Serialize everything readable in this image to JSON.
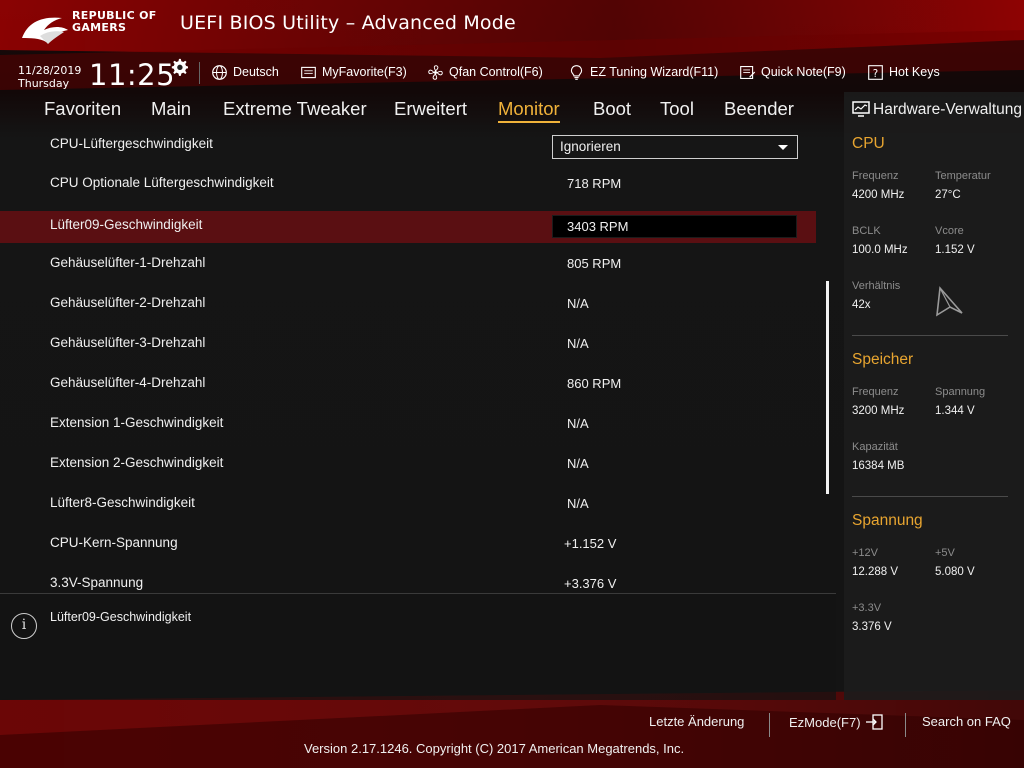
{
  "header": {
    "logo_line1": "REPUBLIC OF",
    "logo_line2": "GAMERS",
    "title": "UEFI BIOS Utility – Advanced Mode"
  },
  "infobar": {
    "date": "11/28/2019",
    "weekday": "Thursday",
    "time": "11:25",
    "language": "Deutsch",
    "myfavorite": "MyFavorite(F3)",
    "qfan": "Qfan Control(F6)",
    "ez_tuning": "EZ Tuning Wizard(F11)",
    "quick_note": "Quick Note(F9)",
    "hot_keys": "Hot Keys"
  },
  "tabs": [
    {
      "label": "Favoriten"
    },
    {
      "label": "Main"
    },
    {
      "label": "Extreme Tweaker"
    },
    {
      "label": "Erweitert"
    },
    {
      "label": "Monitor",
      "active": true
    },
    {
      "label": "Boot"
    },
    {
      "label": "Tool"
    },
    {
      "label": "Beender"
    }
  ],
  "rows": [
    {
      "label": "CPU-Lüftergeschwindigkeit",
      "value": "Ignorieren",
      "type": "dropdown"
    },
    {
      "label": "CPU Optionale Lüftergeschwindigkeit",
      "value": "718 RPM"
    },
    {
      "label": "Lüfter09-Geschwindigkeit",
      "value": "3403 RPM",
      "selected": true
    },
    {
      "label": "Gehäuselüfter-1-Drehzahl",
      "value": "805 RPM"
    },
    {
      "label": "Gehäuselüfter-2-Drehzahl",
      "value": "N/A"
    },
    {
      "label": "Gehäuselüfter-3-Drehzahl",
      "value": "N/A"
    },
    {
      "label": "Gehäuselüfter-4-Drehzahl",
      "value": "860 RPM"
    },
    {
      "label": "Extension 1-Geschwindigkeit",
      "value": "N/A"
    },
    {
      "label": "Extension 2-Geschwindigkeit",
      "value": "N/A"
    },
    {
      "label": "Lüfter8-Geschwindigkeit",
      "value": "N/A"
    },
    {
      "label": "CPU-Kern-Spannung",
      "value": "+1.152 V"
    },
    {
      "label": "3.3V-Spannung",
      "value": "+3.376 V"
    }
  ],
  "help": {
    "text": "Lüfter09-Geschwindigkeit"
  },
  "hardware": {
    "title": "Hardware-Verwaltung",
    "cpu": {
      "heading": "CPU",
      "freq_label": "Frequenz",
      "freq_value": "4200 MHz",
      "temp_label": "Temperatur",
      "temp_value": "27°C",
      "bclk_label": "BCLK",
      "bclk_value": "100.0 MHz",
      "vcore_label": "Vcore",
      "vcore_value": "1.152 V",
      "ratio_label": "Verhältnis",
      "ratio_value": "42x"
    },
    "memory": {
      "heading": "Speicher",
      "freq_label": "Frequenz",
      "freq_value": "3200 MHz",
      "volt_label": "Spannung",
      "volt_value": "1.344 V",
      "cap_label": "Kapazität",
      "cap_value": "16384 MB"
    },
    "voltage": {
      "heading": "Spannung",
      "v12_label": "+12V",
      "v12_value": "12.288 V",
      "v5_label": "+5V",
      "v5_value": "5.080 V",
      "v33_label": "+3.3V",
      "v33_value": "3.376 V"
    }
  },
  "footer": {
    "last_change": "Letzte Änderung",
    "ezmode": "EzMode(F7)",
    "faq": "Search on FAQ",
    "copyright": "Version 2.17.1246. Copyright (C) 2017 American Megatrends, Inc."
  },
  "colors": {
    "accent": "#f0b23a",
    "section_heading": "#e8a530",
    "selected_row": "#5a0f12"
  }
}
